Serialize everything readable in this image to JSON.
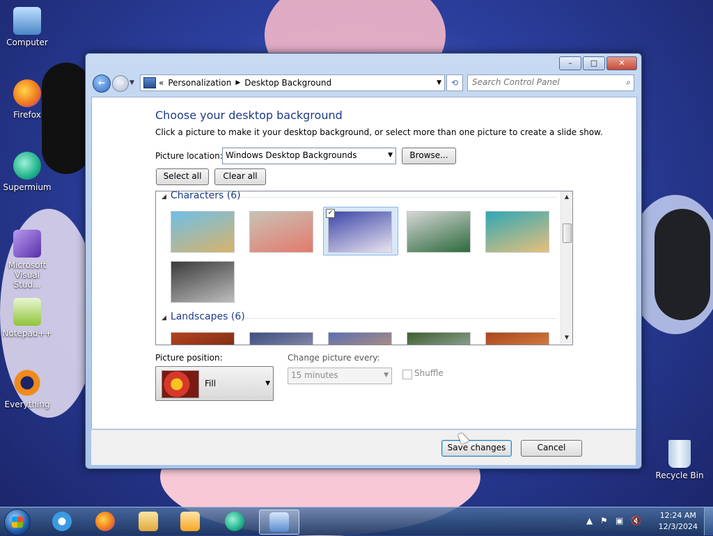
{
  "desktop": {
    "icons": [
      {
        "label": "Computer",
        "icon": "computer-icon",
        "color": "#6aa6e0"
      },
      {
        "label": "Firefox",
        "icon": "firefox-icon",
        "color": "#f07b1e"
      },
      {
        "label": "Supermium",
        "icon": "supermium-icon",
        "color": "#1fb38a"
      },
      {
        "label": "Microsoft Visual Stud...",
        "icon": "visual-studio-icon",
        "color": "#7a4fc7"
      },
      {
        "label": "Notepad++",
        "icon": "notepad-plus-plus-icon",
        "color": "#8fc43a"
      },
      {
        "label": "Everything",
        "icon": "everything-search-icon",
        "color": "#f08a1a"
      },
      {
        "label": "Recycle Bin",
        "icon": "recycle-bin-icon",
        "color": "#cfe0ee"
      }
    ]
  },
  "window": {
    "buttons": {
      "minimize": "–",
      "maximize": "□",
      "close": "✕"
    },
    "address": {
      "prefix": "«",
      "crumbs": [
        "Personalization",
        "Desktop Background"
      ],
      "separator": "▶"
    },
    "search_placeholder": "Search Control Panel",
    "heading": "Choose your desktop background",
    "description": "Click a picture to make it your desktop background, or select more than one picture to create a slide show.",
    "picture_location_label": "Picture location:",
    "picture_location_value": "Windows Desktop Backgrounds",
    "browse_label": "Browse...",
    "select_all_label": "Select all",
    "clear_all_label": "Clear all",
    "groups": [
      {
        "name": "Characters (6)",
        "thumbs": [
          {
            "colors": [
              "#6fbfe8",
              "#d7b36a"
            ],
            "selected": false
          },
          {
            "colors": [
              "#c9c2b6",
              "#e37a6c"
            ],
            "selected": false
          },
          {
            "colors": [
              "#3c46a8",
              "#e9e3ef"
            ],
            "selected": true
          },
          {
            "colors": [
              "#d6d6d6",
              "#2c6a3b"
            ],
            "selected": false
          },
          {
            "colors": [
              "#2fa7b6",
              "#e8c07a"
            ],
            "selected": false
          },
          {
            "colors": [
              "#3b3b3b",
              "#bdbdbd"
            ],
            "selected": false
          }
        ]
      },
      {
        "name": "Landscapes (6)",
        "thumbs": [
          {
            "colors": [
              "#b4431f",
              "#5b1e0e"
            ]
          },
          {
            "colors": [
              "#3d4e80",
              "#b8b2c4"
            ]
          },
          {
            "colors": [
              "#5b6fb3",
              "#e7a25c"
            ]
          },
          {
            "colors": [
              "#3f5f2e",
              "#c2d0d8"
            ]
          },
          {
            "colors": [
              "#a8461d",
              "#f0a45a"
            ]
          }
        ]
      }
    ],
    "picture_position_label": "Picture position:",
    "picture_position_value": "Fill",
    "change_every_label": "Change picture every:",
    "change_every_value": "15 minutes",
    "shuffle_label": "Shuffle",
    "save_label": "Save changes",
    "cancel_label": "Cancel"
  },
  "taskbar": {
    "items": [
      {
        "icon": "internet-explorer-icon",
        "color": "#3b9be0"
      },
      {
        "icon": "firefox-icon",
        "color": "#f07b1e"
      },
      {
        "icon": "file-explorer-icon",
        "color": "#f0c75a"
      },
      {
        "icon": "media-player-icon",
        "color": "#f5a623"
      },
      {
        "icon": "supermium-icon",
        "color": "#1fb38a"
      },
      {
        "icon": "control-panel-icon",
        "color": "#7fb0e6",
        "active": true
      }
    ],
    "time": "12:24 AM",
    "date": "12/3/2024"
  }
}
